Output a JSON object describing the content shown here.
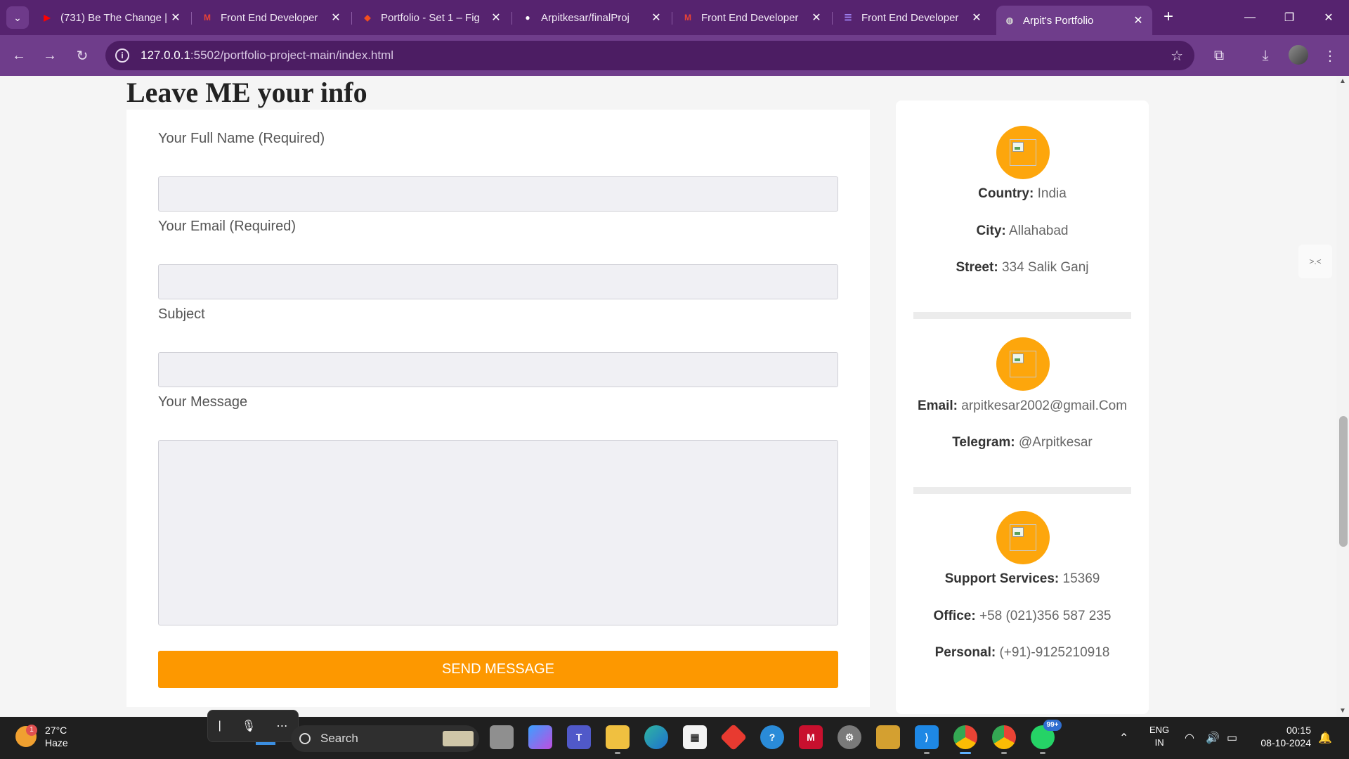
{
  "browser": {
    "tabs": [
      {
        "title": "(731) Be The Change |",
        "favicon": "youtube-icon",
        "color": "#ff0000"
      },
      {
        "title": "Front End Developer",
        "favicon": "gmail-icon",
        "color": "#ea4335"
      },
      {
        "title": "Portfolio - Set 1 – Fig",
        "favicon": "figma-icon",
        "color": "#f24e1e"
      },
      {
        "title": "Arpitkesar/finalProj",
        "favicon": "github-icon",
        "color": "#ffffff"
      },
      {
        "title": "Front End Developer",
        "favicon": "gmail-icon",
        "color": "#ea4335"
      },
      {
        "title": "Front End Developer",
        "favicon": "list-icon",
        "color": "#a58cff"
      },
      {
        "title": "Arpit's Portfolio",
        "favicon": "globe-icon",
        "color": "#cfcfcf"
      }
    ],
    "active_tab_index": 6,
    "url_host": "127.0.0.1",
    "url_rest": ":5502/portfolio-project-main/index.html",
    "accent": "#6f3d8b"
  },
  "page": {
    "section_title": "Leave ME your info",
    "form": {
      "name_label": "Your Full Name (Required)",
      "email_label": "Your Email (Required)",
      "subject_label": "Subject",
      "message_label": "Your Message",
      "name_value": "",
      "email_value": "",
      "subject_value": "",
      "message_value": "",
      "send_label": "SEND MESSAGE",
      "button_color": "#fd9800"
    },
    "contact": {
      "country_label": "Country:",
      "country_value": "India",
      "city_label": "City:",
      "city_value": "Allahabad",
      "street_label": "Street:",
      "street_value": "334 Salik Ganj",
      "email_label": "Email:",
      "email_value": "arpitkesar2002@gmail.Com",
      "telegram_label": "Telegram:",
      "telegram_value": "@Arpitkesar",
      "support_label": "Support Services:",
      "support_value": "15369",
      "office_label": "Office:",
      "office_value": "+58 (021)356 587 235",
      "personal_label": "Personal:",
      "personal_value": "(+91)-9125210918",
      "icon_color": "#fda60c"
    }
  },
  "taskbar": {
    "weather_temp": "27°C",
    "weather_desc": "Haze",
    "weather_badge": "1",
    "search_placeholder": "Search",
    "whatsapp_badge": "99+",
    "lang_line1": "ENG",
    "lang_line2": "IN",
    "time": "00:15",
    "date": "08-10-2024"
  }
}
